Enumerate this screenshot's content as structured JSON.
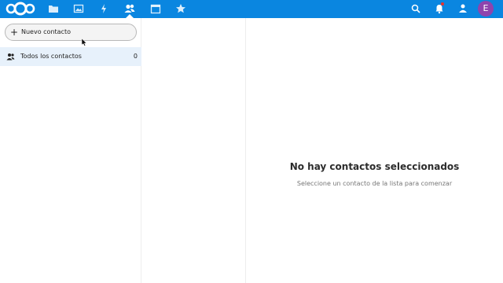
{
  "header": {
    "accent_color": "#0a86e0",
    "logo": "nextcloud-logo",
    "apps": [
      {
        "name": "files-icon"
      },
      {
        "name": "photos-icon"
      },
      {
        "name": "activity-icon"
      },
      {
        "name": "contacts-icon",
        "active": true
      },
      {
        "name": "calendar-icon"
      },
      {
        "name": "favorites-icon"
      }
    ],
    "right_icons": [
      "search-icon",
      "notifications-icon",
      "contacts-menu-icon"
    ],
    "avatar_letter": "E",
    "avatar_color": "#8e44ad"
  },
  "sidebar": {
    "new_contact_label": "Nuevo contacto",
    "items": [
      {
        "label": "Todos los contactos",
        "count": "0",
        "icon": "people-icon"
      }
    ]
  },
  "empty_state": {
    "title": "No hay contactos seleccionados",
    "subtitle": "Seleccione un contacto de la lista para comenzar"
  }
}
